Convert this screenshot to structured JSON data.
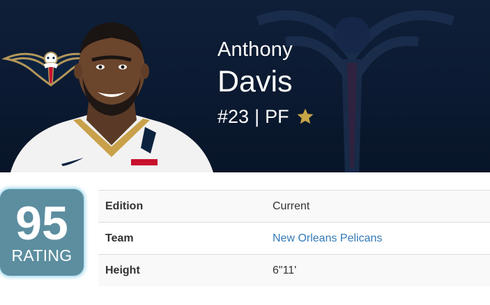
{
  "player": {
    "first_name": "Anthony",
    "last_name": "Davis",
    "number": "#23",
    "separator": "|",
    "position": "PF",
    "photo": "player-headshot",
    "team_logo": "pelicans-logo"
  },
  "rating": {
    "value": "95",
    "label": "RATING"
  },
  "details": {
    "rows": [
      {
        "key": "Edition",
        "value": "Current"
      },
      {
        "key": "Team",
        "value": "New Orleans Pelicans"
      },
      {
        "key": "Height",
        "value": "6\"11'"
      }
    ]
  },
  "colors": {
    "hero_bg": "#0b1a31",
    "badge_bg": "#5c8ea0",
    "badge_glow": "#9fd6ea",
    "link": "#337ab7",
    "star": "#c8a547",
    "pelicans_gold": "#b4975a",
    "pelicans_red": "#c8102e"
  },
  "icons": {
    "star": "star-icon",
    "watermark": "pelican-watermark-icon"
  }
}
